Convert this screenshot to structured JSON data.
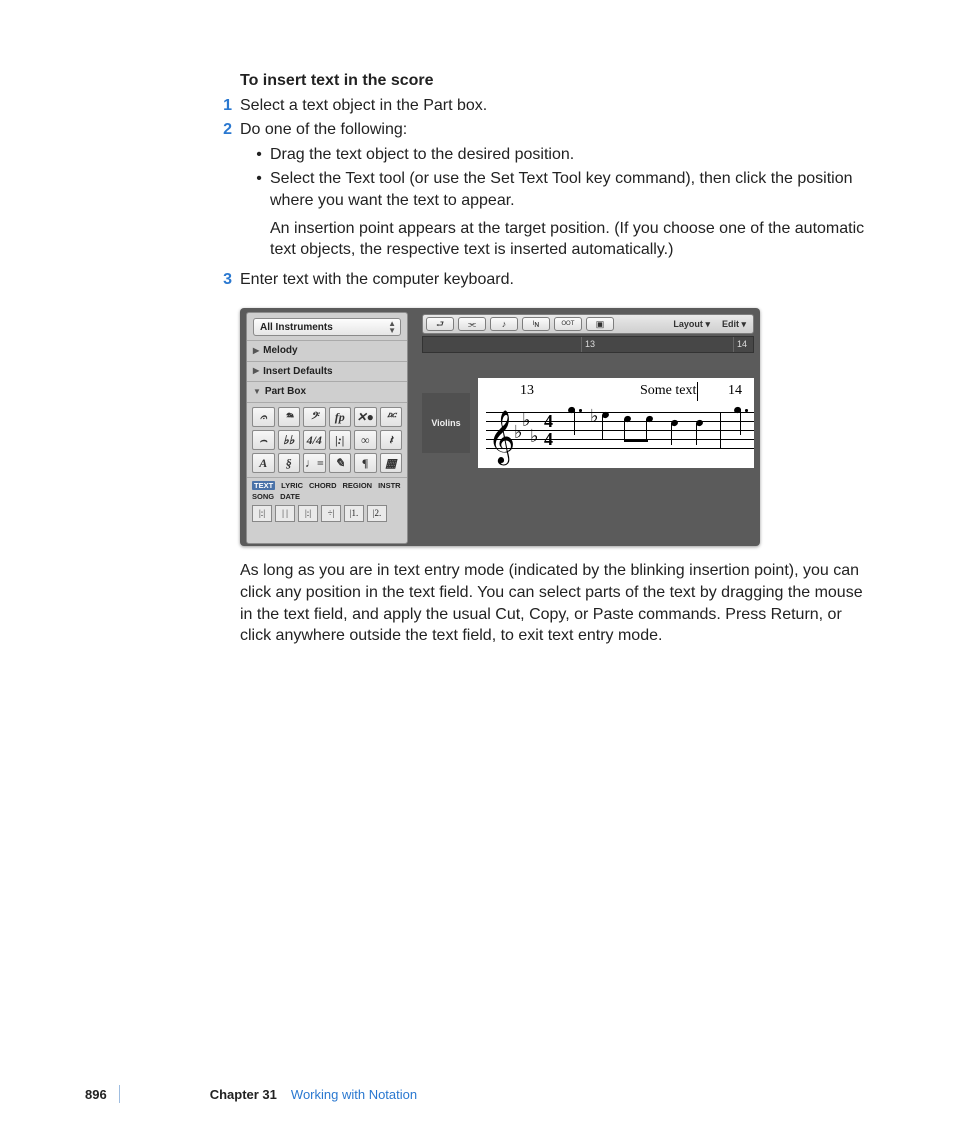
{
  "heading": "To insert text in the score",
  "steps": {
    "s1": {
      "num": "1",
      "text": "Select a text object in the Part box."
    },
    "s2": {
      "num": "2",
      "text": "Do one of the following:"
    },
    "s2a": "Drag the text object to the desired position.",
    "s2b": "Select the Text tool (or use the Set Text Tool key command), then click the position where you want the text to appear.",
    "s2b_extra": "An insertion point appears at the target position. (If you choose one of the automatic text objects, the respective text is inserted automatically.)",
    "s3": {
      "num": "3",
      "text": "Enter text with the computer keyboard."
    }
  },
  "after_figure": "As long as you are in text entry mode (indicated by the blinking insertion point), you can click any position in the text field. You can select parts of the text by dragging the mouse in the text field, and apply the usual Cut, Copy, or Paste commands. Press Return, or click anywhere outside the text field, to exit text entry mode.",
  "footer": {
    "page": "896",
    "chapter": "Chapter 31",
    "title": "Working with Notation"
  },
  "shot": {
    "dropdown": "All Instruments",
    "rows": {
      "melody": "Melody",
      "insert": "Insert Defaults",
      "partbox": "Part Box"
    },
    "palette": [
      "𝄐",
      "𝆮",
      "𝄢",
      "fp",
      "✕●",
      "𝄊",
      "⌢",
      "♭♭",
      "4/4",
      "|:|",
      "∞",
      "𝄽",
      "A",
      "§",
      "♩=",
      "✎",
      "¶",
      "▦"
    ],
    "wordtabs": [
      "TEXT",
      "LYRIC",
      "CHORD",
      "REGION",
      "INSTR",
      "SONG",
      "DATE"
    ],
    "bottomicons": [
      "|:|",
      "| |",
      "|:|",
      "÷|",
      "|1.",
      "|2."
    ],
    "toolbar": {
      "layout": "Layout",
      "edit": "Edit"
    },
    "ruler": {
      "r1": "13",
      "r2": "14"
    },
    "track": "Violins",
    "score": {
      "bar13": "13",
      "bar14": "14",
      "annot": "Some text",
      "ts_top": "4",
      "ts_bot": "4"
    }
  }
}
